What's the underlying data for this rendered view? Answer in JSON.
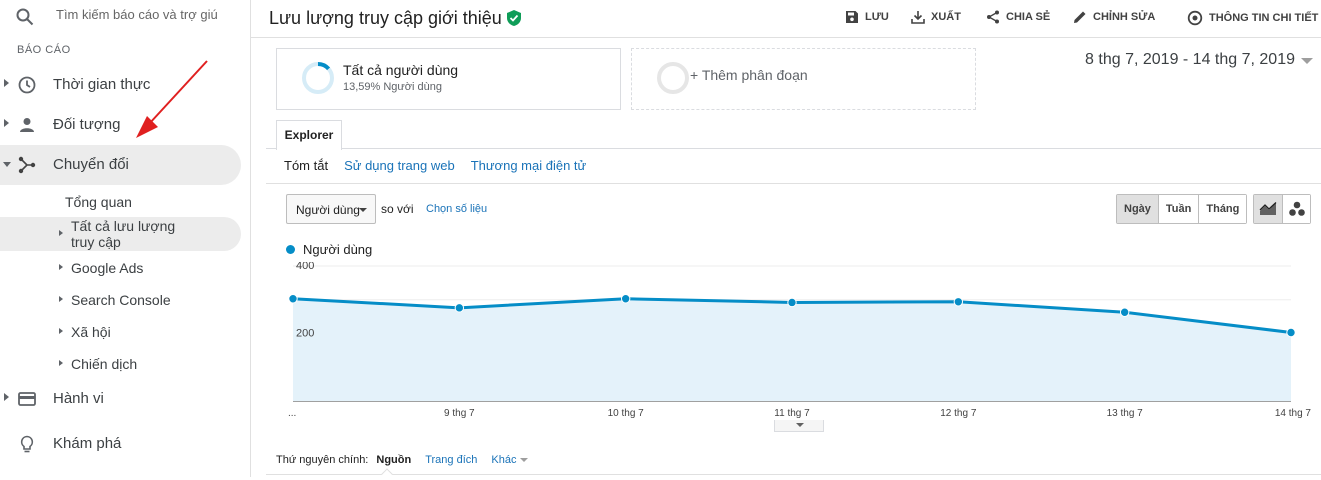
{
  "sidebar": {
    "search": {
      "placeholder": "Tìm kiếm báo cáo và trợ giú"
    },
    "section_label": "BÁO CÁO",
    "items": [
      {
        "label": "Thời gian thực",
        "icon": "clock-icon"
      },
      {
        "label": "Đối tượng",
        "icon": "person-icon"
      },
      {
        "label": "Chuyển đổi",
        "icon": "conversion-icon",
        "expanded": true,
        "active": true
      },
      {
        "label": "Hành vi",
        "icon": "behavior-icon"
      },
      {
        "label": "Khám phá",
        "icon": "lightbulb-icon"
      }
    ],
    "sub_items": [
      {
        "label": "Tổng quan"
      },
      {
        "label": "Tất cả lưu lượng",
        "label2": "truy cập",
        "active": true
      },
      {
        "label": "Google Ads"
      },
      {
        "label": "Search Console"
      },
      {
        "label": "Xã hội"
      },
      {
        "label": "Chiến dịch"
      }
    ]
  },
  "header": {
    "title": "Lưu lượng truy cập giới thiệu",
    "tools": {
      "save": "LƯU",
      "export": "XUẤT",
      "share": "CHIA SẺ",
      "edit": "CHỈNH SỬA",
      "insights": "THÔNG TIN CHI TIẾT"
    }
  },
  "segments": {
    "all_users": {
      "title": "Tất cả người dùng",
      "sub": "13,59% Người dùng",
      "percent": 13.59
    },
    "add": "+ Thêm phân đoạn"
  },
  "date_range": "8 thg 7, 2019 - 14 thg 7, 2019",
  "explorer": {
    "tab": "Explorer",
    "subtabs": [
      "Tóm tắt",
      "Sử dụng trang web",
      "Thương mại điện tử"
    ],
    "metric": "Người dùng",
    "compare": "so với",
    "pick_metric": "Chọn số liệu",
    "granularity": [
      "Ngày",
      "Tuần",
      "Tháng"
    ],
    "granularity_selected": "Ngày"
  },
  "chart_data": {
    "type": "area",
    "series": [
      {
        "name": "Người dùng",
        "values": [
          303,
          276,
          303,
          292,
          294,
          263,
          203
        ]
      }
    ],
    "x": [
      "...",
      "9 thg 7",
      "10 thg 7",
      "11 thg 7",
      "12 thg 7",
      "13 thg 7",
      "14 thg 7"
    ],
    "ylim": [
      0,
      400
    ],
    "yticks": [
      "200",
      "400"
    ],
    "color": "#058dc7",
    "fill": "#e4f2fa",
    "grid": true
  },
  "dimensions": {
    "label": "Thứ nguyên chính:",
    "current": "Nguồn",
    "link": "Trang đích",
    "more": "Khác"
  }
}
